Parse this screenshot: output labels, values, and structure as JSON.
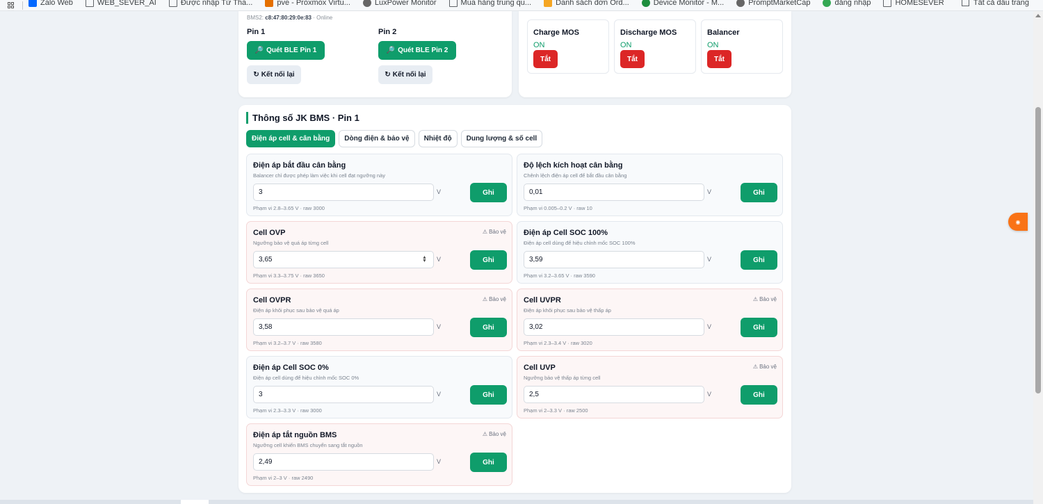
{
  "bookmarks": {
    "items": [
      {
        "label": "Zalo Web",
        "icon": "zalo-icon",
        "color": "#0068ff"
      },
      {
        "label": "WEB_SEVER_AI",
        "icon": "folder-icon",
        "color": ""
      },
      {
        "label": "Được nhập Từ Tha...",
        "icon": "folder-icon",
        "color": ""
      },
      {
        "label": "pve - Proxmox Virtu...",
        "icon": "proxmox-icon",
        "color": "#e57000"
      },
      {
        "label": "LuxPower Monitor",
        "icon": "globe-icon",
        "color": "#666666"
      },
      {
        "label": "Mua hàng trung qu...",
        "icon": "folder-icon",
        "color": ""
      },
      {
        "label": "Danh sách đơn Ord...",
        "icon": "bird-icon",
        "color": "#f5a623"
      },
      {
        "label": "Device Monitor - M...",
        "icon": "sheets-icon",
        "color": "#1e8e3e"
      },
      {
        "label": "PromptMarketCap",
        "icon": "globe-icon",
        "color": "#666666"
      },
      {
        "label": "đăng nhập",
        "icon": "g-icon",
        "color": "#34a853"
      },
      {
        "label": "HOMESEVER",
        "icon": "folder-icon",
        "color": ""
      }
    ],
    "all_bookmarks": "Tất cả dấu trang"
  },
  "connection": {
    "bms2_label": "BMS2:",
    "bms2_mac": "c8:47:80:29:0e:83",
    "bms2_status": "· Online",
    "pins": [
      {
        "title": "Pin 1",
        "scan_label": "Quét BLE Pin 1",
        "reconnect_label": "Kết nối lại"
      },
      {
        "title": "Pin 2",
        "scan_label": "Quét BLE Pin 2",
        "reconnect_label": "Kết nối lại"
      }
    ]
  },
  "switches": [
    {
      "title": "Charge MOS",
      "state": "ON",
      "button": "Tắt"
    },
    {
      "title": "Discharge MOS",
      "state": "ON",
      "button": "Tắt"
    },
    {
      "title": "Balancer",
      "state": "ON",
      "button": "Tắt"
    }
  ],
  "section": {
    "title": "Thông số JK BMS · Pin 1",
    "tabs": [
      "Điện áp cell & cân bằng",
      "Dòng điện & bảo vệ",
      "Nhiệt độ",
      "Dung lượng & số cell"
    ],
    "active_tab": 0
  },
  "params": [
    {
      "title": "Điện áp bắt đầu cân bằng",
      "desc": "Balancer chỉ được phép làm việc khi cell đạt ngưỡng này",
      "value": "3",
      "unit": "V",
      "button": "Ghi",
      "range": "Phạm vi 2.8–3.65 V · raw 3000",
      "badge": ""
    },
    {
      "title": "Độ lệch kích hoạt cân bằng",
      "desc": "Chênh lệch điện áp cell để bắt đầu cân bằng",
      "value": "0,01",
      "unit": "V",
      "button": "Ghi",
      "range": "Phạm vi 0.005–0.2 V · raw 10",
      "badge": ""
    },
    {
      "title": "Cell OVP",
      "desc": "Ngưỡng bảo vệ quá áp từng cell",
      "value": "3,65",
      "unit": "V",
      "button": "Ghi",
      "range": "Phạm vi 3.3–3.75 V · raw 3650",
      "badge": "Bảo vệ"
    },
    {
      "title": "Điện áp Cell SOC 100%",
      "desc": "Điện áp cell dùng để hiệu chỉnh mốc SOC 100%",
      "value": "3,59",
      "unit": "V",
      "button": "Ghi",
      "range": "Phạm vi 3.2–3.65 V · raw 3590",
      "badge": ""
    },
    {
      "title": "Cell OVPR",
      "desc": "Điện áp khôi phục sau bảo vệ quá áp",
      "value": "3,58",
      "unit": "V",
      "button": "Ghi",
      "range": "Phạm vi 3.2–3.7 V · raw 3580",
      "badge": "Bảo vệ"
    },
    {
      "title": "Cell UVPR",
      "desc": "Điện áp khôi phục sau bảo vệ thấp áp",
      "value": "3,02",
      "unit": "V",
      "button": "Ghi",
      "range": "Phạm vi 2.3–3.4 V · raw 3020",
      "badge": "Bảo vệ"
    },
    {
      "title": "Điện áp Cell SOC 0%",
      "desc": "Điện áp cell dùng để hiệu chỉnh mốc SOC 0%",
      "value": "3",
      "unit": "V",
      "button": "Ghi",
      "range": "Phạm vi 2.3–3.3 V · raw 3000",
      "badge": ""
    },
    {
      "title": "Cell UVP",
      "desc": "Ngưỡng bảo vệ thấp áp từng cell",
      "value": "2,5",
      "unit": "V",
      "button": "Ghi",
      "range": "Phạm vi 2–3.3 V · raw 2500",
      "badge": "Bảo vệ"
    },
    {
      "title": "Điện áp tắt nguồn BMS",
      "desc": "Ngưỡng cell khiến BMS chuyển sang tắt nguồn",
      "value": "2,49",
      "unit": "V",
      "button": "Ghi",
      "range": "Phạm vi 2–3 V · raw 2490",
      "badge": "Bảo vệ"
    }
  ]
}
